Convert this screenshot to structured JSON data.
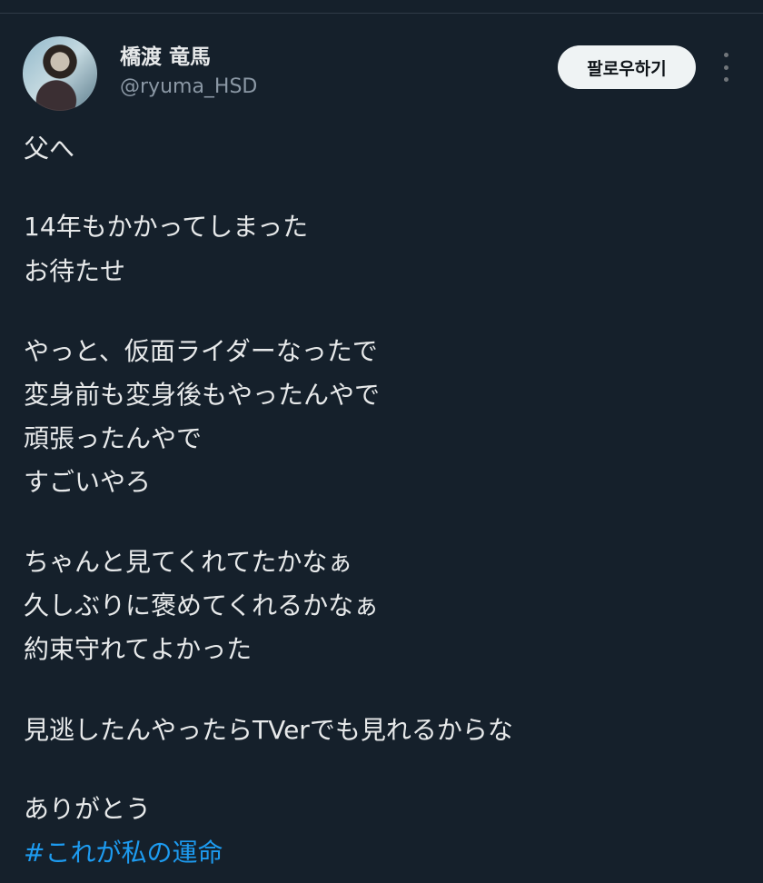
{
  "author": {
    "display_name": "橋渡 竜馬",
    "handle": "@ryuma_HSD",
    "avatar": "avatar-photo"
  },
  "header": {
    "follow_label": "팔로우하기",
    "more_icon": "more-vertical-icon"
  },
  "tweet": {
    "lines": [
      "父へ",
      "14年もかかってしまった",
      "お待たせ",
      "やっと、仮面ライダーなったで",
      "変身前も変身後もやったんやで",
      "頑張ったんやで",
      "すごいやろ",
      "ちゃんと見てくれてたかなぁ",
      "久しぶりに褒めてくれるかなぁ",
      "約束守れてよかった",
      "見逃したんやったらTVerでも見れるからな",
      "ありがとう"
    ],
    "hashtag": "#これが私の運命"
  },
  "colors": {
    "background": "#15202b",
    "text": "#e7e9ea",
    "secondary_text": "#8b98a5",
    "link": "#1d9bf0",
    "button_bg": "#eff3f4"
  }
}
